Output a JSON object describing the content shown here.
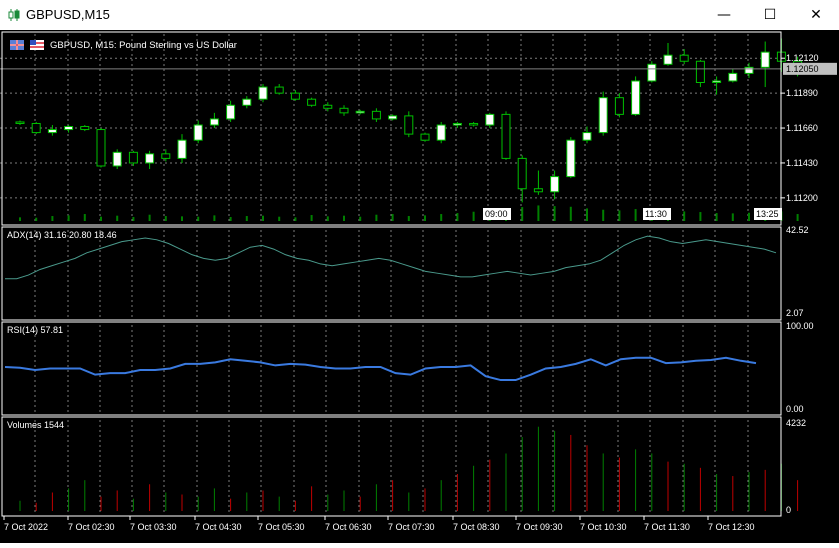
{
  "window": {
    "title": "GBPUSD,M15",
    "minimize_icon": "minimize-icon",
    "maximize_icon": "maximize-icon",
    "close_icon": "close-icon"
  },
  "chart_header": {
    "symbol_text": "GBPUSD, M15:  Pound Sterling vs US Dollar"
  },
  "indicators": {
    "adx_label": "ADX(14) 31.16 20.80 18.46",
    "rsi_label": "RSI(14) 57.81",
    "volumes_label": "Volumes 1544"
  },
  "colors": {
    "background": "#000000",
    "grid": "#c0c0c0",
    "bull_candle": "#ffffff",
    "bear_candle": "#000000",
    "wick": "#00c000",
    "adx_line": "#4a9a8c",
    "rsi_line": "#3a7ae0",
    "volume_up": "#008000",
    "volume_down": "#c00000"
  },
  "price_axis": {
    "labels": [
      "1.12120",
      "1.11890",
      "1.11660",
      "1.11430",
      "1.11200"
    ],
    "current_price": "1.12050"
  },
  "adx_axis": {
    "labels": [
      "42.52",
      "2.07"
    ]
  },
  "rsi_axis": {
    "labels": [
      "100.00",
      "0.00"
    ]
  },
  "volume_axis": {
    "labels": [
      "4232",
      "0"
    ]
  },
  "time_markers": [
    "09:00",
    "11:30",
    "13:25"
  ],
  "time_axis": {
    "labels": [
      "7 Oct 2022",
      "7 Oct 02:30",
      "7 Oct 03:30",
      "7 Oct 04:30",
      "7 Oct 05:30",
      "7 Oct 06:30",
      "7 Oct 07:30",
      "7 Oct 08:30",
      "7 Oct 09:30",
      "7 Oct 10:30",
      "7 Oct 11:30",
      "7 Oct 12:30"
    ]
  },
  "chart_data": {
    "type": "candlestick",
    "price_range": [
      1.1112,
      1.1224
    ],
    "candles": [
      {
        "o": 1.117,
        "h": 1.1171,
        "l": 1.1168,
        "c": 1.1169
      },
      {
        "o": 1.1169,
        "h": 1.117,
        "l": 1.1162,
        "c": 1.1163
      },
      {
        "o": 1.1163,
        "h": 1.1168,
        "l": 1.1161,
        "c": 1.1165
      },
      {
        "o": 1.1165,
        "h": 1.1168,
        "l": 1.1163,
        "c": 1.1167
      },
      {
        "o": 1.1167,
        "h": 1.1168,
        "l": 1.1164,
        "c": 1.1165
      },
      {
        "o": 1.1165,
        "h": 1.1166,
        "l": 1.114,
        "c": 1.1141
      },
      {
        "o": 1.1141,
        "h": 1.1152,
        "l": 1.1139,
        "c": 1.115
      },
      {
        "o": 1.115,
        "h": 1.1151,
        "l": 1.1141,
        "c": 1.1143
      },
      {
        "o": 1.1143,
        "h": 1.1151,
        "l": 1.1139,
        "c": 1.1149
      },
      {
        "o": 1.1149,
        "h": 1.1152,
        "l": 1.1144,
        "c": 1.1146
      },
      {
        "o": 1.1146,
        "h": 1.1162,
        "l": 1.1143,
        "c": 1.1158
      },
      {
        "o": 1.1158,
        "h": 1.1171,
        "l": 1.1156,
        "c": 1.1168
      },
      {
        "o": 1.1168,
        "h": 1.1176,
        "l": 1.1166,
        "c": 1.1172
      },
      {
        "o": 1.1172,
        "h": 1.1184,
        "l": 1.117,
        "c": 1.1181
      },
      {
        "o": 1.1181,
        "h": 1.1187,
        "l": 1.1179,
        "c": 1.1185
      },
      {
        "o": 1.1185,
        "h": 1.1195,
        "l": 1.1183,
        "c": 1.1193
      },
      {
        "o": 1.1193,
        "h": 1.1195,
        "l": 1.1188,
        "c": 1.1189
      },
      {
        "o": 1.1189,
        "h": 1.1191,
        "l": 1.1184,
        "c": 1.1185
      },
      {
        "o": 1.1185,
        "h": 1.1186,
        "l": 1.118,
        "c": 1.1181
      },
      {
        "o": 1.1181,
        "h": 1.1183,
        "l": 1.1177,
        "c": 1.1179
      },
      {
        "o": 1.1179,
        "h": 1.1181,
        "l": 1.1174,
        "c": 1.1176
      },
      {
        "o": 1.1176,
        "h": 1.1178,
        "l": 1.1175,
        "c": 1.1177
      },
      {
        "o": 1.1177,
        "h": 1.1179,
        "l": 1.117,
        "c": 1.1172
      },
      {
        "o": 1.1172,
        "h": 1.1175,
        "l": 1.1171,
        "c": 1.1174
      },
      {
        "o": 1.1174,
        "h": 1.1177,
        "l": 1.116,
        "c": 1.1162
      },
      {
        "o": 1.1162,
        "h": 1.1163,
        "l": 1.1157,
        "c": 1.1158
      },
      {
        "o": 1.1158,
        "h": 1.117,
        "l": 1.1156,
        "c": 1.1168
      },
      {
        "o": 1.1168,
        "h": 1.117,
        "l": 1.1166,
        "c": 1.1169
      },
      {
        "o": 1.1169,
        "h": 1.117,
        "l": 1.1167,
        "c": 1.1168
      },
      {
        "o": 1.1168,
        "h": 1.1176,
        "l": 1.1166,
        "c": 1.1175
      },
      {
        "o": 1.1175,
        "h": 1.1177,
        "l": 1.1145,
        "c": 1.1146
      },
      {
        "o": 1.1146,
        "h": 1.1148,
        "l": 1.1117,
        "c": 1.1126
      },
      {
        "o": 1.1126,
        "h": 1.1138,
        "l": 1.1122,
        "c": 1.1124
      },
      {
        "o": 1.1124,
        "h": 1.1138,
        "l": 1.1119,
        "c": 1.1134
      },
      {
        "o": 1.1134,
        "h": 1.116,
        "l": 1.1133,
        "c": 1.1158
      },
      {
        "o": 1.1158,
        "h": 1.1167,
        "l": 1.1156,
        "c": 1.1163
      },
      {
        "o": 1.1163,
        "h": 1.119,
        "l": 1.1161,
        "c": 1.1186
      },
      {
        "o": 1.1186,
        "h": 1.1189,
        "l": 1.1173,
        "c": 1.1175
      },
      {
        "o": 1.1175,
        "h": 1.12,
        "l": 1.1174,
        "c": 1.1197
      },
      {
        "o": 1.1197,
        "h": 1.121,
        "l": 1.1196,
        "c": 1.1208
      },
      {
        "o": 1.1208,
        "h": 1.1222,
        "l": 1.1207,
        "c": 1.1214
      },
      {
        "o": 1.1214,
        "h": 1.1218,
        "l": 1.1208,
        "c": 1.121
      },
      {
        "o": 1.121,
        "h": 1.1211,
        "l": 1.1193,
        "c": 1.1196
      },
      {
        "o": 1.1196,
        "h": 1.12,
        "l": 1.1188,
        "c": 1.1197
      },
      {
        "o": 1.1197,
        "h": 1.1205,
        "l": 1.1196,
        "c": 1.1202
      },
      {
        "o": 1.1202,
        "h": 1.1209,
        "l": 1.1199,
        "c": 1.1206
      },
      {
        "o": 1.1206,
        "h": 1.1223,
        "l": 1.1193,
        "c": 1.1216
      },
      {
        "o": 1.1216,
        "h": 1.1225,
        "l": 1.1203,
        "c": 1.121
      },
      {
        "o": 1.121,
        "h": 1.1213,
        "l": 1.12,
        "c": 1.1205
      }
    ],
    "adx": {
      "range": [
        2.07,
        42.52
      ],
      "values": [
        20,
        20,
        22,
        25,
        27,
        29,
        31,
        34,
        36,
        38,
        40,
        41,
        42,
        41,
        39,
        36,
        33,
        31,
        30,
        31,
        34,
        37,
        38,
        36,
        33,
        31,
        30,
        28,
        27,
        28,
        29,
        30,
        31,
        30,
        28,
        26,
        24,
        23,
        22,
        21,
        21,
        22,
        23,
        24,
        23,
        22,
        23,
        24,
        26,
        27,
        28,
        30,
        34,
        38,
        41,
        43,
        42,
        40,
        39,
        40,
        41,
        40,
        39,
        38,
        37,
        36,
        34
      ]
    },
    "rsi": {
      "range": [
        0,
        100
      ],
      "values": [
        52,
        51,
        48,
        50,
        50,
        50,
        42,
        44,
        44,
        48,
        48,
        50,
        56,
        56,
        58,
        62,
        60,
        58,
        54,
        56,
        55,
        52,
        50,
        50,
        52,
        52,
        44,
        42,
        50,
        52,
        52,
        54,
        40,
        35,
        35,
        42,
        50,
        52,
        56,
        62,
        54,
        62,
        64,
        64,
        57,
        58,
        60,
        61,
        64,
        60,
        57
      ]
    },
    "volumes": {
      "range": [
        0,
        4232
      ],
      "bars": [
        {
          "v": 500,
          "up": true
        },
        {
          "v": 400,
          "up": false
        },
        {
          "v": 900,
          "up": false
        },
        {
          "v": 1100,
          "up": true
        },
        {
          "v": 1500,
          "up": true
        },
        {
          "v": 700,
          "up": false
        },
        {
          "v": 1000,
          "up": false
        },
        {
          "v": 600,
          "up": true
        },
        {
          "v": 1300,
          "up": false
        },
        {
          "v": 900,
          "up": true
        },
        {
          "v": 800,
          "up": false
        },
        {
          "v": 700,
          "up": true
        },
        {
          "v": 1100,
          "up": true
        },
        {
          "v": 600,
          "up": false
        },
        {
          "v": 900,
          "up": true
        },
        {
          "v": 1000,
          "up": false
        },
        {
          "v": 700,
          "up": true
        },
        {
          "v": 500,
          "up": false
        },
        {
          "v": 1200,
          "up": false
        },
        {
          "v": 800,
          "up": true
        },
        {
          "v": 1000,
          "up": true
        },
        {
          "v": 700,
          "up": false
        },
        {
          "v": 1300,
          "up": true
        },
        {
          "v": 1500,
          "up": false
        },
        {
          "v": 900,
          "up": true
        },
        {
          "v": 1100,
          "up": false
        },
        {
          "v": 1500,
          "up": true
        },
        {
          "v": 1800,
          "up": false
        },
        {
          "v": 2200,
          "up": true
        },
        {
          "v": 2500,
          "up": false
        },
        {
          "v": 2800,
          "up": true
        },
        {
          "v": 3600,
          "up": true
        },
        {
          "v": 4100,
          "up": true
        },
        {
          "v": 3900,
          "up": true
        },
        {
          "v": 3700,
          "up": false
        },
        {
          "v": 3200,
          "up": false
        },
        {
          "v": 2800,
          "up": true
        },
        {
          "v": 2600,
          "up": false
        },
        {
          "v": 3000,
          "up": true
        },
        {
          "v": 2800,
          "up": true
        },
        {
          "v": 2400,
          "up": false
        },
        {
          "v": 2300,
          "up": true
        },
        {
          "v": 2100,
          "up": false
        },
        {
          "v": 1800,
          "up": true
        },
        {
          "v": 1700,
          "up": false
        },
        {
          "v": 1900,
          "up": true
        },
        {
          "v": 2000,
          "up": false
        },
        {
          "v": 2300,
          "up": true
        },
        {
          "v": 1500,
          "up": false
        }
      ]
    }
  }
}
